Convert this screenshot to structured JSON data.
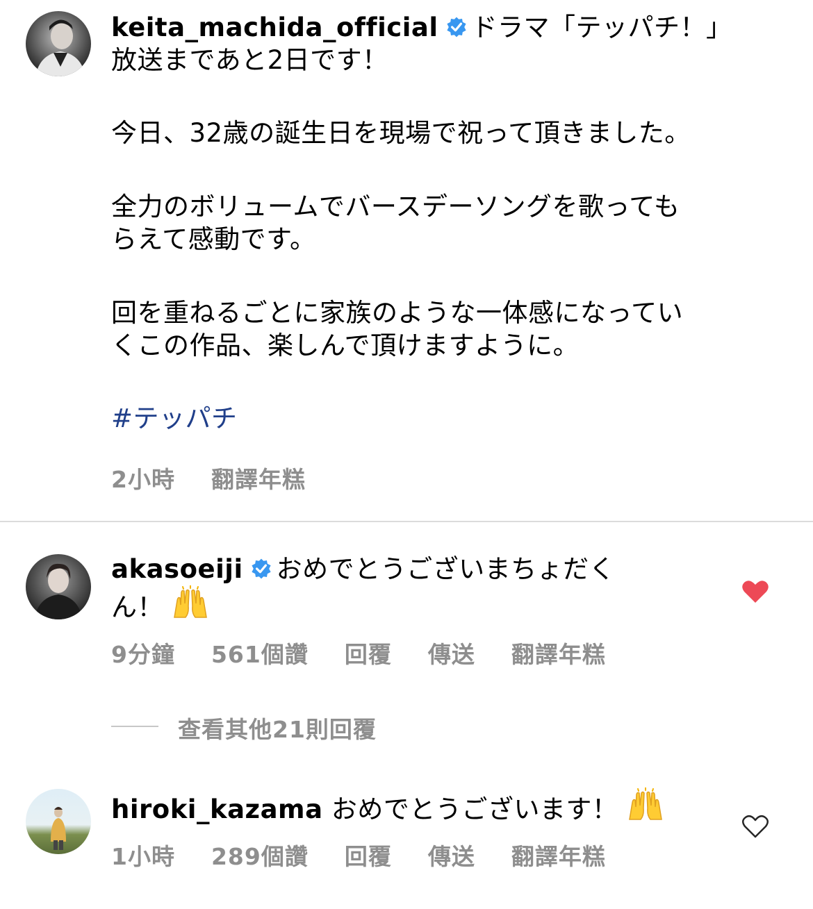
{
  "post": {
    "username": "keita_machida_official",
    "verified": true,
    "caption_head": "ドラマ「テッパチ！」",
    "caption_lines": [
      "放送まであと2日です！",
      "",
      "今日、32歳の誕生日を現場で祝って頂きました。",
      "",
      "全力のボリュームでバースデーソングを歌っても",
      "らえて感動です。",
      "",
      "回を重ねるごとに家族のような一体感になってい",
      "くこの作品、楽しんで頂けますように。",
      ""
    ],
    "hashtag": "#テッパチ",
    "time": "2小時",
    "translate": "翻譯年糕"
  },
  "comments": [
    {
      "username": "akasoeiji",
      "verified": true,
      "text_line1": "おめでとうございまちょだく",
      "text_line2": "ん！",
      "emoji": "🙌",
      "time": "9分鐘",
      "likes": "561個讚",
      "reply": "回覆",
      "send": "傳送",
      "translate": "翻譯年糕",
      "liked": true,
      "view_replies": "查看其他21則回覆"
    },
    {
      "username": "hiroki_kazama",
      "verified": false,
      "text": "おめでとうございます！",
      "emoji": "🙌",
      "time": "1小時",
      "likes": "289個讚",
      "reply": "回覆",
      "send": "傳送",
      "translate": "翻譯年糕",
      "liked": false
    }
  ],
  "colors": {
    "heart_liked": "#ed4956",
    "meta_gray": "#8e8e8e",
    "hashtag": "#203f8a",
    "verified": "#3897f0"
  }
}
